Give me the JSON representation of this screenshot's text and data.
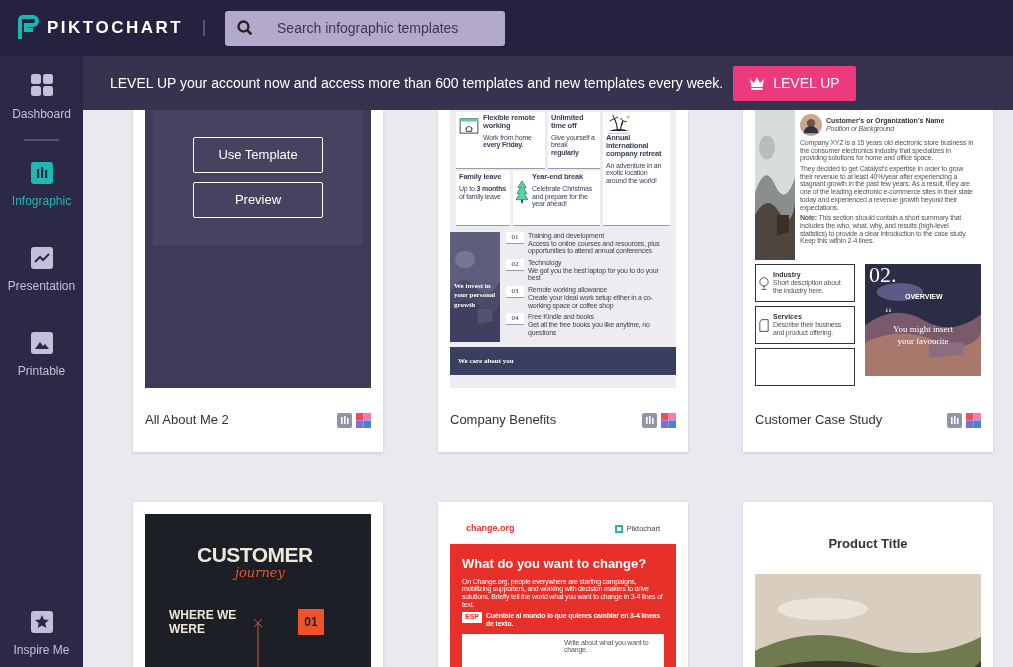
{
  "header": {
    "logo": "PIKTOCHART",
    "search": {
      "placeholder": "Search infographic templates"
    }
  },
  "sidebar": {
    "items": [
      {
        "label": "Dashboard",
        "kind": "dashboard",
        "selected": false
      },
      {
        "label": "Infographic",
        "kind": "infographic",
        "selected": true
      },
      {
        "label": "Presentation",
        "kind": "presentation",
        "selected": false
      },
      {
        "label": "Printable",
        "kind": "printable",
        "selected": false
      }
    ],
    "bottom_item": {
      "label": "Inspire Me",
      "kind": "inspire",
      "selected": false
    }
  },
  "banner": {
    "text": "LEVEL UP your account now and access more than 600 templates and new templates every week.",
    "button": "LEVEL UP"
  },
  "templates": [
    {
      "kind": "hover",
      "title": "All About Me 2",
      "actions": [
        "Use Template",
        "Preview"
      ]
    },
    {
      "kind": "benefits",
      "title": "Company Benefits",
      "tiles": [
        {
          "title": "Flexible remote working",
          "text": "Work from home **every Friday.**"
        },
        {
          "title": "Unlimited time off",
          "text": "Give yourself a break **regularly**"
        },
        {
          "title": "Annual international company retreat",
          "text": "An adventure in an exotic location around the world!"
        },
        {
          "title": "Family leave",
          "text": "Up to **3 months** of family leave"
        },
        {
          "title": "Year-end break",
          "text": "Celebrate Christmas and prepare for the year ahead!"
        }
      ],
      "panel": "We invest in your personal growth",
      "list": [
        {
          "number": "01",
          "title": "Training and development",
          "text": "Access to online courses and resources, plus opportunities to attend annual conferences"
        },
        {
          "number": "02",
          "title": "Technology",
          "text": "We got you the best laptop for you to do your best"
        },
        {
          "number": "03",
          "title": "Remote working allowance",
          "text": "Create your ideal work setup either in a co-working space or coffee shop"
        },
        {
          "number": "04",
          "title": "Free Kindle and books",
          "text": "Get all the free books you like anytime, no questions"
        }
      ],
      "band": "We care about you"
    },
    {
      "kind": "case_study",
      "title": "Customer Case Study",
      "name": "Customer's or Organization's Name",
      "role": "Position or Background",
      "paragraphs": [
        "Company XYZ is a 15 years old electronic store business in the consumer electronics industry that specializes in providing solutions for home and office space.",
        "They decided to get Catalyst's expertise in order to grow their revenue to at least 40%/year after experiencing a stagnant growth in the past few years. As a result, they are one of the leading electronic e-commerce sites in their state today and experienced a revenue growth beyond their expectations."
      ],
      "note": "**Note:** This section should contain a short summary that includes the who, what, why, and results (high-level statistics) to provide a clear introduction to the case study. Keep this within 2-4 lines.",
      "facts": [
        {
          "title": "Industry",
          "text": "Short description about the industry here."
        },
        {
          "title": "Services",
          "text": "Describe their business and product offering."
        }
      ],
      "overview": {
        "number": "02.",
        "label": "OVERVIEW",
        "quote_mark": "“",
        "quote": "You might insert your favourite"
      }
    },
    {
      "kind": "journey",
      "title": "CUSTOMER",
      "script": "journey",
      "stage": "WHERE WE WERE",
      "number": "01"
    },
    {
      "kind": "change",
      "brand": "change.org",
      "partner": "Piktochart",
      "heading": "What do you want to change?",
      "body": "On Change.org, people everywhere are starting campaigns, mobilizing supporters, and working with decision makers to drive solutions. Briefly tell the world what you want to change in 3-4 lines of text.",
      "lang": "ESP",
      "translation": "Cuéntale al mundo lo que quieres cambiar en 3-4 líneas de texto.",
      "prompt": "Write about what you want to change."
    },
    {
      "kind": "product",
      "title": "Product Title"
    }
  ]
}
